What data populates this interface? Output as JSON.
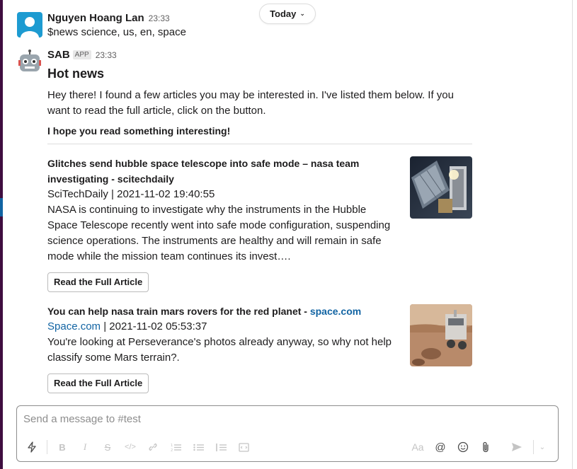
{
  "date_divider": {
    "label": "Today"
  },
  "user_message": {
    "author": "Nguyen Hoang Lan",
    "time": "23:33",
    "text": "$news science, us, en, space"
  },
  "bot_message": {
    "author": "SAB",
    "app_badge": "APP",
    "time": "23:33",
    "heading": "Hot news",
    "intro": "Hey there! I found a few articles you may be interested in. I've listed them below. If you want to read the full article, click on the button.",
    "closing": "I hope you read something interesting!",
    "articles": [
      {
        "title": "Glitches send hubble space telescope into safe mode – nasa team investigating - scitechdaily",
        "source": "SciTechDaily",
        "date": "2021-11-02 19:40:55",
        "summary": "NASA is continuing to investigate why the instruments in the Hubble Space Telescope recently went into safe mode configuration, suspending science operations. The instruments are healthy and will remain in safe mode while the mission team continues its invest….",
        "button": "Read the Full Article",
        "thumbnail": "hubble-telescope-image"
      },
      {
        "title": "You can help nasa train mars rovers for the red planet - ",
        "title_link": "space.com",
        "source": "Space.com",
        "date": "2021-11-02 05:53:37",
        "summary": "You're looking at Perseverance's photos already anyway, so why not help classify some Mars terrain?.",
        "button": "Read the Full Article",
        "thumbnail": "mars-rover-image"
      }
    ]
  },
  "composer": {
    "placeholder": "Send a message to #test",
    "value": "",
    "left_tools": [
      "lightning-icon",
      "bold-icon",
      "italic-icon",
      "strikethrough-icon",
      "code-icon",
      "link-icon",
      "ordered-list-icon",
      "bulleted-list-icon",
      "blockquote-icon",
      "code-block-icon"
    ],
    "right_tools": [
      "format-text-icon",
      "mention-icon",
      "emoji-icon",
      "attach-icon",
      "send-icon",
      "send-options-chevron-icon"
    ]
  },
  "colors": {
    "sidebar": "#3f0e40",
    "link": "#1264a3",
    "text": "#1d1c1d",
    "muted": "#616061"
  }
}
